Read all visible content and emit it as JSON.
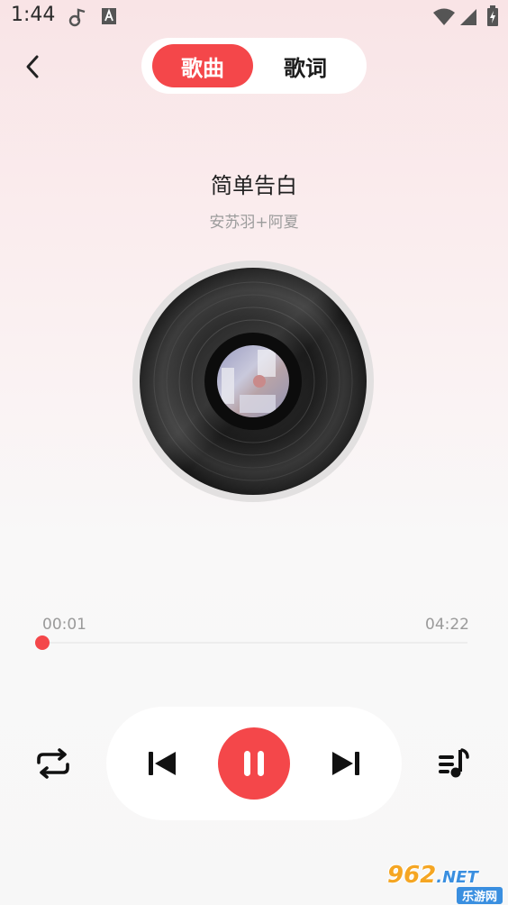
{
  "status_bar": {
    "time": "1:44",
    "icons": [
      "music-notification-icon",
      "text-a-icon",
      "wifi-icon",
      "cellular-signal-icon",
      "battery-charging-icon"
    ]
  },
  "header": {
    "back_icon": "chevron-left-icon",
    "tabs": [
      {
        "label": "歌曲",
        "active": true
      },
      {
        "label": "歌词",
        "active": false
      }
    ]
  },
  "song": {
    "title": "简单告白",
    "artist": "安苏羽+阿夏"
  },
  "progress": {
    "current": "00:01",
    "total": "04:22",
    "fraction": 0.004
  },
  "controls": {
    "repeat_icon": "repeat-icon",
    "previous_icon": "skip-previous-icon",
    "pause_icon": "pause-icon",
    "next_icon": "skip-next-icon",
    "playlist_icon": "playlist-music-icon"
  },
  "watermark": {
    "logo_text": "962",
    "logo_suffix": ".NET",
    "caption": "乐游网"
  },
  "colors": {
    "accent": "#f4474a",
    "background_top": "#f9e4e6",
    "background_bottom": "#f7f7f7"
  }
}
